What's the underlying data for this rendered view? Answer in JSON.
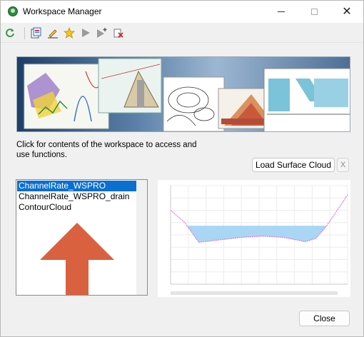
{
  "window": {
    "title": "Workspace Manager"
  },
  "toolbar": {
    "buttons": [
      {
        "name": "refresh-icon",
        "tooltip": ""
      },
      {
        "name": "open-workspace-icon",
        "tooltip": ""
      },
      {
        "name": "edit-icon",
        "tooltip": ""
      },
      {
        "name": "favorite-star-icon",
        "tooltip": ""
      },
      {
        "name": "play-icon",
        "tooltip": ""
      },
      {
        "name": "play-add-icon",
        "tooltip": ""
      },
      {
        "name": "delete-icon",
        "tooltip": ""
      }
    ]
  },
  "description": "Click for contents of the workspace to access and use functions.",
  "buttons": {
    "load_surface_cloud": "Load Surface Cloud",
    "clear": "X",
    "close": "Close"
  },
  "workspace_list": {
    "items": [
      "ChannelRate_WSPRO",
      "ChannelRate_WSPRO_drain",
      "ContourCloud"
    ],
    "selected_index": 0
  },
  "colors": {
    "selection": "#0a6fd0",
    "arrow": "#d9613f",
    "profile_fill": "#a9d6f5",
    "profile_line": "#e675d9"
  },
  "chart_data": {
    "type": "area",
    "x": [
      0,
      8,
      16,
      28,
      40,
      52,
      64,
      76,
      82,
      88,
      96,
      100
    ],
    "y": [
      12,
      10,
      6.8,
      7.2,
      7.6,
      7.8,
      7.6,
      6.9,
      7.4,
      9.4,
      12.8,
      14.5
    ],
    "water_level": 9.5
  }
}
